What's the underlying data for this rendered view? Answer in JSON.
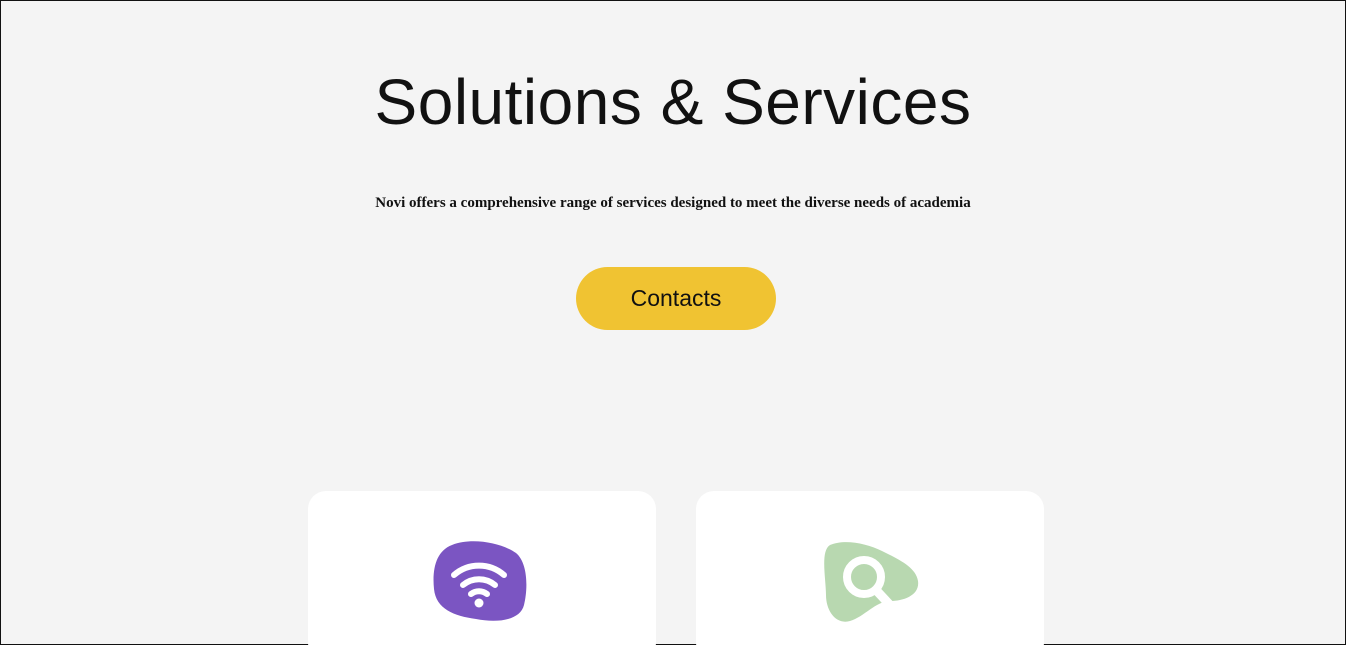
{
  "hero": {
    "title": "Solutions & Services",
    "subtitle": "Novi offers a comprehensive range of services designed to meet the diverse needs of academia",
    "cta_label": "Contacts"
  },
  "cards": [
    {
      "icon": "wifi-icon",
      "icon_color": "#7b55c2"
    },
    {
      "icon": "search-icon",
      "icon_color": "#b8d8b0"
    }
  ],
  "colors": {
    "background": "#f4f4f4",
    "accent": "#f0c332",
    "card": "#ffffff"
  }
}
